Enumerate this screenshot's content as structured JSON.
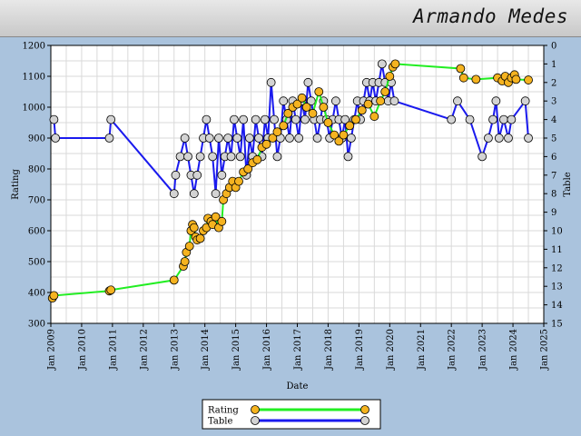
{
  "player_name": "Armando Medes",
  "colors": {
    "background": "#aac3dd",
    "plot_bg": "#ffffff",
    "grid": "#d9d9d9",
    "rating_line": "#22ee22",
    "rating_marker": "#f5b320",
    "table_line": "#1a1aee",
    "table_marker": "#d3d3d3"
  },
  "chart_data": {
    "type": "line",
    "title": "",
    "xlabel": "Date",
    "ylabel": "Rating",
    "y2label": "Table",
    "xlim": [
      2009,
      2025
    ],
    "ylim": [
      300,
      1200
    ],
    "y2lim": [
      15,
      0
    ],
    "x_ticks": [
      2009,
      2010,
      2011,
      2012,
      2013,
      2014,
      2015,
      2016,
      2017,
      2018,
      2019,
      2020,
      2021,
      2022,
      2023,
      2024,
      2025
    ],
    "x_tick_labels": [
      "Jan 2009",
      "Jan 2010",
      "Jan 2011",
      "Jan 2012",
      "Jan 2013",
      "Jan 2014",
      "Jan 2015",
      "Jan 2016",
      "Jan 2017",
      "Jan 2018",
      "Jan 2019",
      "Jan 2020",
      "Jan 2021",
      "Jan 2022",
      "Jan 2023",
      "Jan 2024",
      "Jan 2025"
    ],
    "y_ticks": [
      300,
      400,
      500,
      600,
      700,
      800,
      900,
      1000,
      1100,
      1200
    ],
    "y2_ticks": [
      0,
      1,
      2,
      3,
      4,
      5,
      6,
      7,
      8,
      9,
      10,
      11,
      12,
      13,
      14,
      15
    ],
    "grid": true,
    "legend": {
      "placement": "bottom-center",
      "entries": [
        "Rating",
        "Table"
      ]
    },
    "series": [
      {
        "name": "Rating",
        "axis": "left",
        "points": [
          [
            2009.05,
            382
          ],
          [
            2009.1,
            390
          ],
          [
            2010.9,
            405
          ],
          [
            2010.95,
            408
          ],
          [
            2013.0,
            440
          ],
          [
            2013.3,
            485
          ],
          [
            2013.35,
            500
          ],
          [
            2013.4,
            530
          ],
          [
            2013.5,
            550
          ],
          [
            2013.55,
            600
          ],
          [
            2013.6,
            620
          ],
          [
            2013.65,
            610
          ],
          [
            2013.7,
            580
          ],
          [
            2013.75,
            570
          ],
          [
            2013.85,
            575
          ],
          [
            2013.95,
            600
          ],
          [
            2014.05,
            610
          ],
          [
            2014.1,
            640
          ],
          [
            2014.2,
            630
          ],
          [
            2014.25,
            620
          ],
          [
            2014.35,
            645
          ],
          [
            2014.45,
            610
          ],
          [
            2014.55,
            630
          ],
          [
            2014.6,
            700
          ],
          [
            2014.7,
            720
          ],
          [
            2014.8,
            740
          ],
          [
            2014.9,
            760
          ],
          [
            2015.0,
            740
          ],
          [
            2015.1,
            760
          ],
          [
            2015.25,
            790
          ],
          [
            2015.4,
            800
          ],
          [
            2015.55,
            820
          ],
          [
            2015.7,
            830
          ],
          [
            2015.85,
            870
          ],
          [
            2016.0,
            880
          ],
          [
            2016.2,
            900
          ],
          [
            2016.35,
            920
          ],
          [
            2016.55,
            940
          ],
          [
            2016.7,
            980
          ],
          [
            2016.85,
            1000
          ],
          [
            2017.0,
            1010
          ],
          [
            2017.15,
            1030
          ],
          [
            2017.3,
            1000
          ],
          [
            2017.5,
            980
          ],
          [
            2017.7,
            1050
          ],
          [
            2017.85,
            1000
          ],
          [
            2018.0,
            950
          ],
          [
            2018.2,
            910
          ],
          [
            2018.35,
            890
          ],
          [
            2018.5,
            910
          ],
          [
            2018.7,
            940
          ],
          [
            2018.9,
            960
          ],
          [
            2019.1,
            990
          ],
          [
            2019.3,
            1010
          ],
          [
            2019.5,
            970
          ],
          [
            2019.7,
            1020
          ],
          [
            2019.85,
            1050
          ],
          [
            2020.0,
            1100
          ],
          [
            2020.1,
            1130
          ],
          [
            2020.18,
            1140
          ],
          [
            2022.3,
            1125
          ],
          [
            2022.4,
            1095
          ],
          [
            2022.8,
            1090
          ],
          [
            2023.5,
            1095
          ],
          [
            2023.65,
            1085
          ],
          [
            2023.75,
            1100
          ],
          [
            2023.85,
            1080
          ],
          [
            2023.95,
            1095
          ],
          [
            2024.05,
            1105
          ],
          [
            2024.1,
            1090
          ],
          [
            2024.5,
            1088
          ]
        ]
      },
      {
        "name": "Table",
        "axis": "right",
        "points": [
          [
            2009.1,
            4
          ],
          [
            2009.15,
            5
          ],
          [
            2010.9,
            5
          ],
          [
            2010.95,
            4
          ],
          [
            2013.0,
            8
          ],
          [
            2013.05,
            7
          ],
          [
            2013.2,
            6
          ],
          [
            2013.35,
            5
          ],
          [
            2013.45,
            6
          ],
          [
            2013.55,
            7
          ],
          [
            2013.65,
            8
          ],
          [
            2013.75,
            7
          ],
          [
            2013.85,
            6
          ],
          [
            2013.95,
            5
          ],
          [
            2014.05,
            4
          ],
          [
            2014.15,
            5
          ],
          [
            2014.25,
            6
          ],
          [
            2014.35,
            8
          ],
          [
            2014.45,
            5
          ],
          [
            2014.55,
            7
          ],
          [
            2014.65,
            6
          ],
          [
            2014.75,
            5
          ],
          [
            2014.85,
            6
          ],
          [
            2014.95,
            4
          ],
          [
            2015.05,
            5
          ],
          [
            2015.15,
            6
          ],
          [
            2015.25,
            4
          ],
          [
            2015.35,
            7
          ],
          [
            2015.45,
            5
          ],
          [
            2015.55,
            6
          ],
          [
            2015.65,
            4
          ],
          [
            2015.75,
            5
          ],
          [
            2015.85,
            6
          ],
          [
            2015.95,
            4
          ],
          [
            2016.05,
            5
          ],
          [
            2016.15,
            2
          ],
          [
            2016.25,
            4
          ],
          [
            2016.35,
            6
          ],
          [
            2016.45,
            5
          ],
          [
            2016.55,
            3
          ],
          [
            2016.65,
            4
          ],
          [
            2016.75,
            5
          ],
          [
            2016.85,
            3
          ],
          [
            2016.95,
            4
          ],
          [
            2017.05,
            5
          ],
          [
            2017.15,
            3
          ],
          [
            2017.25,
            4
          ],
          [
            2017.35,
            2
          ],
          [
            2017.45,
            3
          ],
          [
            2017.55,
            4
          ],
          [
            2017.65,
            5
          ],
          [
            2017.75,
            4
          ],
          [
            2017.85,
            3
          ],
          [
            2017.95,
            4
          ],
          [
            2018.05,
            5
          ],
          [
            2018.15,
            4
          ],
          [
            2018.25,
            3
          ],
          [
            2018.35,
            4
          ],
          [
            2018.45,
            5
          ],
          [
            2018.55,
            4
          ],
          [
            2018.65,
            6
          ],
          [
            2018.75,
            5
          ],
          [
            2018.85,
            4
          ],
          [
            2018.95,
            3
          ],
          [
            2019.05,
            4
          ],
          [
            2019.15,
            3
          ],
          [
            2019.25,
            2
          ],
          [
            2019.35,
            3
          ],
          [
            2019.45,
            2
          ],
          [
            2019.55,
            3
          ],
          [
            2019.65,
            2
          ],
          [
            2019.75,
            1
          ],
          [
            2019.85,
            2
          ],
          [
            2019.95,
            3
          ],
          [
            2020.05,
            2
          ],
          [
            2020.15,
            3
          ],
          [
            2022.0,
            4
          ],
          [
            2022.2,
            3
          ],
          [
            2022.6,
            4
          ],
          [
            2023.0,
            6
          ],
          [
            2023.2,
            5
          ],
          [
            2023.35,
            4
          ],
          [
            2023.45,
            3
          ],
          [
            2023.55,
            5
          ],
          [
            2023.7,
            4
          ],
          [
            2023.85,
            5
          ],
          [
            2023.95,
            4
          ],
          [
            2024.4,
            3
          ],
          [
            2024.5,
            5
          ]
        ]
      }
    ]
  }
}
